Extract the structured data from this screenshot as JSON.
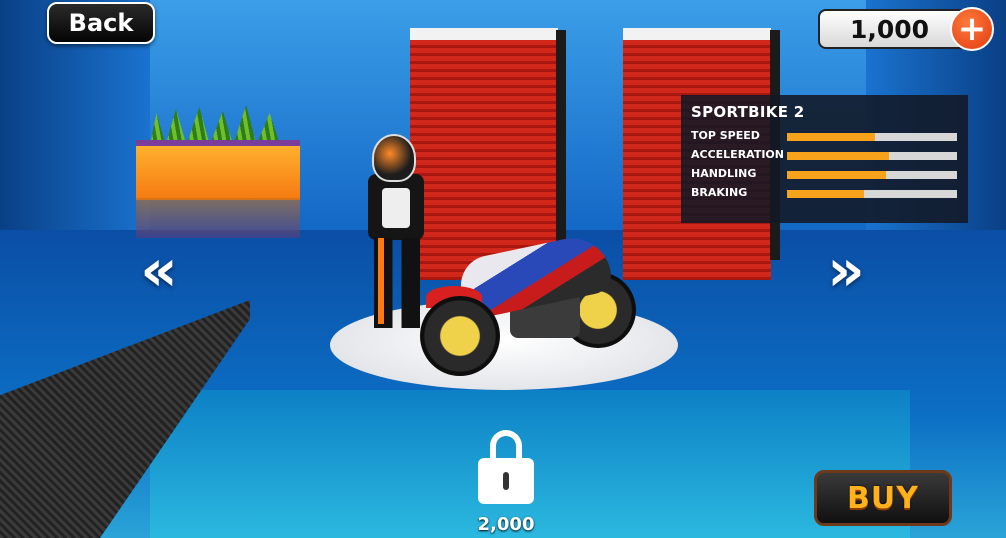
{
  "top_bar": {
    "back_label": "Back",
    "coins": "1,000",
    "add_coins_symbol": "+"
  },
  "stats_panel": {
    "title": "SPORTBIKE 2",
    "stats": [
      {
        "label": "TOP SPEED",
        "level": 0.52
      },
      {
        "label": "ACCELERATION",
        "level": 0.6
      },
      {
        "label": "HANDLING",
        "level": 0.58
      },
      {
        "label": "BRAKING",
        "level": 0.45
      }
    ]
  },
  "navigation": {
    "prev_icon": "chevron-left-icon",
    "next_icon": "chevron-right-icon"
  },
  "lock": {
    "icon": "padlock-icon",
    "price": "2,000"
  },
  "buy_label": "BUY",
  "colors": {
    "stat_bar": "#f6a21b",
    "buy_text": "#ffb21a",
    "add_button": "#e23a10"
  }
}
